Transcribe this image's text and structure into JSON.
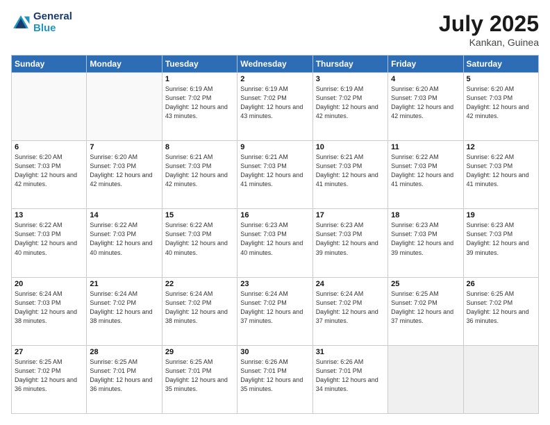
{
  "header": {
    "logo_line1": "General",
    "logo_line2": "Blue",
    "month_year": "July 2025",
    "location": "Kankan, Guinea"
  },
  "days_of_week": [
    "Sunday",
    "Monday",
    "Tuesday",
    "Wednesday",
    "Thursday",
    "Friday",
    "Saturday"
  ],
  "weeks": [
    [
      {
        "day": "",
        "info": ""
      },
      {
        "day": "",
        "info": ""
      },
      {
        "day": "1",
        "info": "Sunrise: 6:19 AM\nSunset: 7:02 PM\nDaylight: 12 hours and 43 minutes."
      },
      {
        "day": "2",
        "info": "Sunrise: 6:19 AM\nSunset: 7:02 PM\nDaylight: 12 hours and 43 minutes."
      },
      {
        "day": "3",
        "info": "Sunrise: 6:19 AM\nSunset: 7:02 PM\nDaylight: 12 hours and 42 minutes."
      },
      {
        "day": "4",
        "info": "Sunrise: 6:20 AM\nSunset: 7:03 PM\nDaylight: 12 hours and 42 minutes."
      },
      {
        "day": "5",
        "info": "Sunrise: 6:20 AM\nSunset: 7:03 PM\nDaylight: 12 hours and 42 minutes."
      }
    ],
    [
      {
        "day": "6",
        "info": "Sunrise: 6:20 AM\nSunset: 7:03 PM\nDaylight: 12 hours and 42 minutes."
      },
      {
        "day": "7",
        "info": "Sunrise: 6:20 AM\nSunset: 7:03 PM\nDaylight: 12 hours and 42 minutes."
      },
      {
        "day": "8",
        "info": "Sunrise: 6:21 AM\nSunset: 7:03 PM\nDaylight: 12 hours and 42 minutes."
      },
      {
        "day": "9",
        "info": "Sunrise: 6:21 AM\nSunset: 7:03 PM\nDaylight: 12 hours and 41 minutes."
      },
      {
        "day": "10",
        "info": "Sunrise: 6:21 AM\nSunset: 7:03 PM\nDaylight: 12 hours and 41 minutes."
      },
      {
        "day": "11",
        "info": "Sunrise: 6:22 AM\nSunset: 7:03 PM\nDaylight: 12 hours and 41 minutes."
      },
      {
        "day": "12",
        "info": "Sunrise: 6:22 AM\nSunset: 7:03 PM\nDaylight: 12 hours and 41 minutes."
      }
    ],
    [
      {
        "day": "13",
        "info": "Sunrise: 6:22 AM\nSunset: 7:03 PM\nDaylight: 12 hours and 40 minutes."
      },
      {
        "day": "14",
        "info": "Sunrise: 6:22 AM\nSunset: 7:03 PM\nDaylight: 12 hours and 40 minutes."
      },
      {
        "day": "15",
        "info": "Sunrise: 6:22 AM\nSunset: 7:03 PM\nDaylight: 12 hours and 40 minutes."
      },
      {
        "day": "16",
        "info": "Sunrise: 6:23 AM\nSunset: 7:03 PM\nDaylight: 12 hours and 40 minutes."
      },
      {
        "day": "17",
        "info": "Sunrise: 6:23 AM\nSunset: 7:03 PM\nDaylight: 12 hours and 39 minutes."
      },
      {
        "day": "18",
        "info": "Sunrise: 6:23 AM\nSunset: 7:03 PM\nDaylight: 12 hours and 39 minutes."
      },
      {
        "day": "19",
        "info": "Sunrise: 6:23 AM\nSunset: 7:03 PM\nDaylight: 12 hours and 39 minutes."
      }
    ],
    [
      {
        "day": "20",
        "info": "Sunrise: 6:24 AM\nSunset: 7:03 PM\nDaylight: 12 hours and 38 minutes."
      },
      {
        "day": "21",
        "info": "Sunrise: 6:24 AM\nSunset: 7:02 PM\nDaylight: 12 hours and 38 minutes."
      },
      {
        "day": "22",
        "info": "Sunrise: 6:24 AM\nSunset: 7:02 PM\nDaylight: 12 hours and 38 minutes."
      },
      {
        "day": "23",
        "info": "Sunrise: 6:24 AM\nSunset: 7:02 PM\nDaylight: 12 hours and 37 minutes."
      },
      {
        "day": "24",
        "info": "Sunrise: 6:24 AM\nSunset: 7:02 PM\nDaylight: 12 hours and 37 minutes."
      },
      {
        "day": "25",
        "info": "Sunrise: 6:25 AM\nSunset: 7:02 PM\nDaylight: 12 hours and 37 minutes."
      },
      {
        "day": "26",
        "info": "Sunrise: 6:25 AM\nSunset: 7:02 PM\nDaylight: 12 hours and 36 minutes."
      }
    ],
    [
      {
        "day": "27",
        "info": "Sunrise: 6:25 AM\nSunset: 7:02 PM\nDaylight: 12 hours and 36 minutes."
      },
      {
        "day": "28",
        "info": "Sunrise: 6:25 AM\nSunset: 7:01 PM\nDaylight: 12 hours and 36 minutes."
      },
      {
        "day": "29",
        "info": "Sunrise: 6:25 AM\nSunset: 7:01 PM\nDaylight: 12 hours and 35 minutes."
      },
      {
        "day": "30",
        "info": "Sunrise: 6:26 AM\nSunset: 7:01 PM\nDaylight: 12 hours and 35 minutes."
      },
      {
        "day": "31",
        "info": "Sunrise: 6:26 AM\nSunset: 7:01 PM\nDaylight: 12 hours and 34 minutes."
      },
      {
        "day": "",
        "info": ""
      },
      {
        "day": "",
        "info": ""
      }
    ]
  ]
}
